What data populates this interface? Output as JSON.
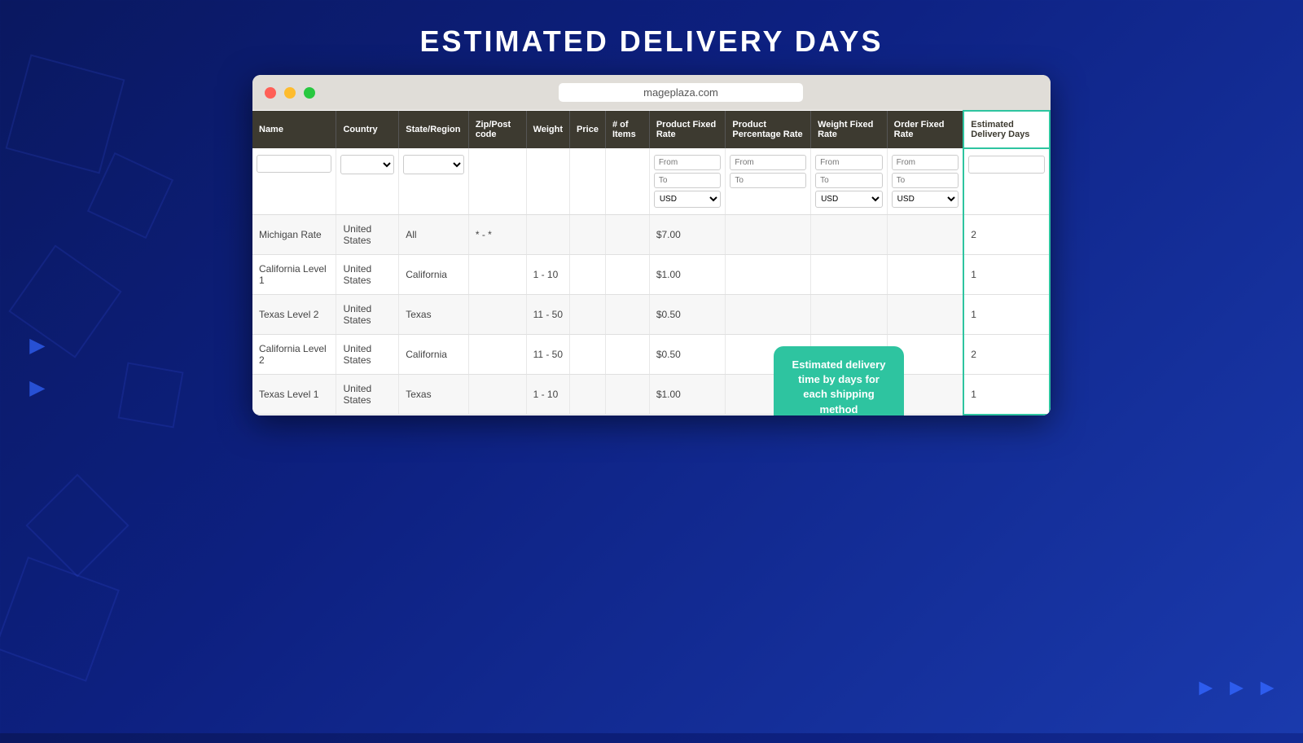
{
  "page": {
    "title": "ESTIMATED DELIVERY DAYS",
    "url": "mageplaza.com"
  },
  "browser": {
    "dots": [
      "red",
      "yellow",
      "green"
    ]
  },
  "table": {
    "columns": [
      {
        "key": "name",
        "label": "Name"
      },
      {
        "key": "country",
        "label": "Country"
      },
      {
        "key": "state",
        "label": "State/Region"
      },
      {
        "key": "zip",
        "label": "Zip/Post code"
      },
      {
        "key": "weight",
        "label": "Weight"
      },
      {
        "key": "price",
        "label": "Price"
      },
      {
        "key": "num_items",
        "label": "# of Items"
      },
      {
        "key": "product_fixed_rate",
        "label": "Product Fixed Rate"
      },
      {
        "key": "product_percentage_rate",
        "label": "Product Percentage Rate"
      },
      {
        "key": "weight_fixed_rate",
        "label": "Weight Fixed Rate"
      },
      {
        "key": "order_fixed_rate",
        "label": "Order Fixed Rate"
      },
      {
        "key": "estimated_delivery_days",
        "label": "Estimated Delivery Days"
      }
    ],
    "filters": {
      "name_placeholder": "",
      "country_placeholder": "",
      "state_placeholder": "",
      "from_label": "From",
      "to_label": "To",
      "usd_label": "USD"
    },
    "rows": [
      {
        "name": "Michigan Rate",
        "country": "United States",
        "state": "All",
        "zip": "* - *",
        "weight": "",
        "price": "",
        "num_items": "",
        "product_fixed_rate": "$7.00",
        "product_percentage_rate": "",
        "weight_fixed_rate": "",
        "order_fixed_rate": "",
        "estimated_delivery_days": "2"
      },
      {
        "name": "California Level 1",
        "country": "United States",
        "state": "California",
        "zip": "",
        "weight": "1 - 10",
        "price": "",
        "num_items": "",
        "product_fixed_rate": "$1.00",
        "product_percentage_rate": "",
        "weight_fixed_rate": "",
        "order_fixed_rate": "",
        "estimated_delivery_days": "1"
      },
      {
        "name": "Texas Level 2",
        "country": "United States",
        "state": "Texas",
        "zip": "",
        "weight": "11 - 50",
        "price": "",
        "num_items": "",
        "product_fixed_rate": "$0.50",
        "product_percentage_rate": "",
        "weight_fixed_rate": "",
        "order_fixed_rate": "",
        "estimated_delivery_days": "1"
      },
      {
        "name": "California Level 2",
        "country": "United States",
        "state": "California",
        "zip": "",
        "weight": "11 - 50",
        "price": "",
        "num_items": "",
        "product_fixed_rate": "$0.50",
        "product_percentage_rate": "",
        "weight_fixed_rate": "",
        "order_fixed_rate": "",
        "estimated_delivery_days": "2"
      },
      {
        "name": "Texas Level 1",
        "country": "United States",
        "state": "Texas",
        "zip": "",
        "weight": "1 - 10",
        "price": "",
        "num_items": "",
        "product_fixed_rate": "$1.00",
        "product_percentage_rate": "",
        "weight_fixed_rate": "",
        "order_fixed_rate": "",
        "estimated_delivery_days": "1"
      }
    ]
  },
  "tooltip": {
    "text": "Estimated delivery time by days for each shipping method"
  },
  "colors": {
    "header_bg": "#3d3a30",
    "highlight": "#2ec4a0",
    "bg": "#0d1f6e"
  }
}
